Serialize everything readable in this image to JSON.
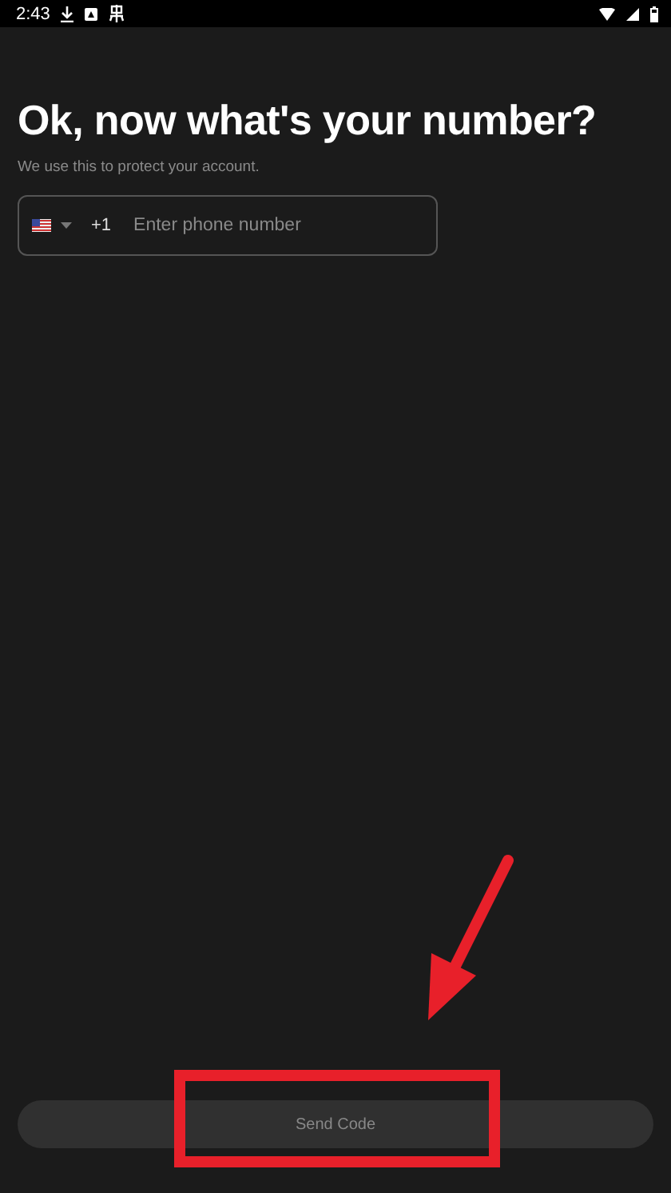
{
  "status_bar": {
    "time": "2:43"
  },
  "title": "Ok, now what's your number?",
  "subtitle": "We use this to protect your account.",
  "phone_field": {
    "country_code": "+1",
    "placeholder": "Enter phone number"
  },
  "send_button": {
    "label": "Send Code",
    "disabled": true
  }
}
